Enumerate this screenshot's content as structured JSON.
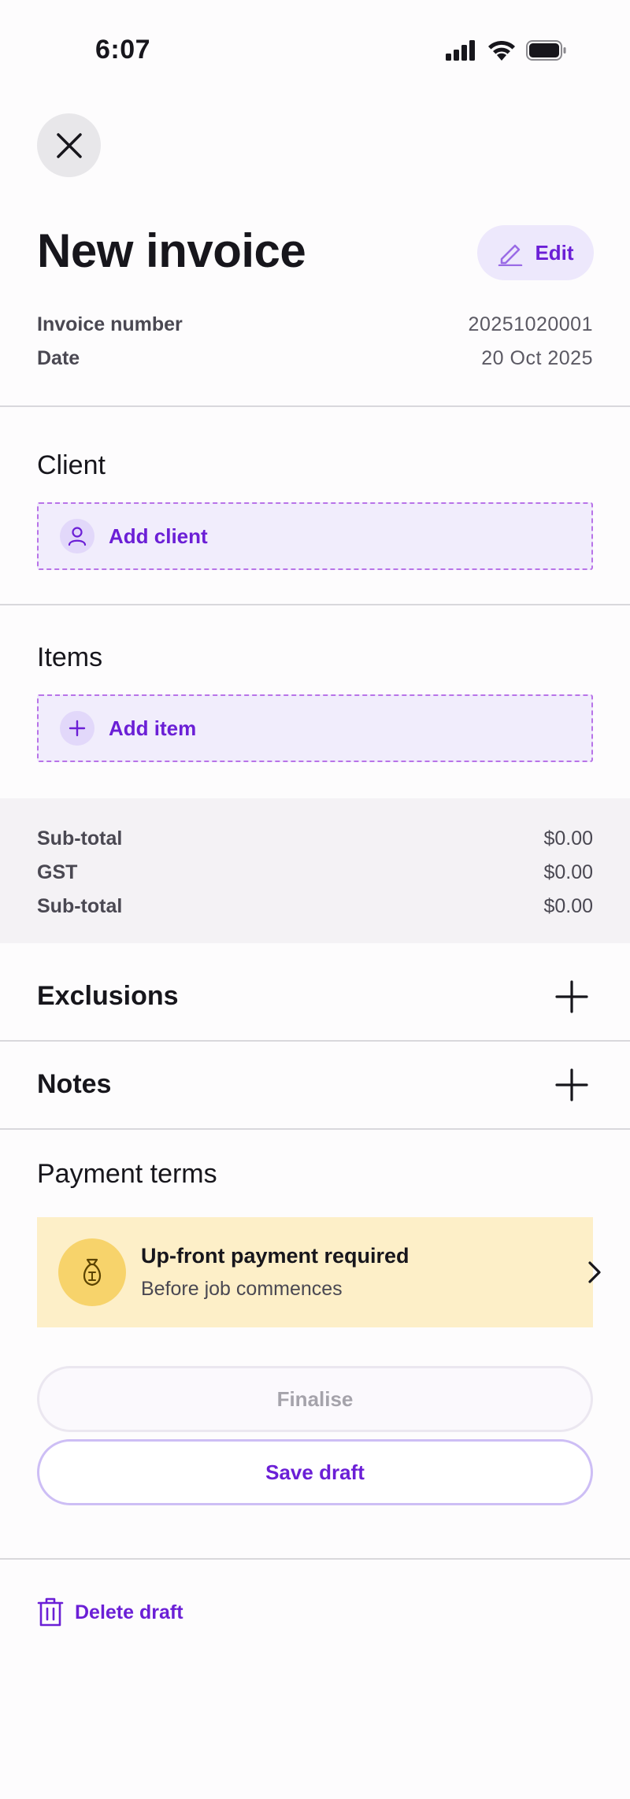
{
  "status_bar": {
    "time": "6:07"
  },
  "header": {
    "title": "New invoice",
    "edit_label": "Edit"
  },
  "meta": {
    "invoice_number_label": "Invoice number",
    "invoice_number_value": "20251020001",
    "date_label": "Date",
    "date_value": "20 Oct 2025"
  },
  "client": {
    "title": "Client",
    "add_label": "Add client"
  },
  "items": {
    "title": "Items",
    "add_label": "Add item"
  },
  "totals": [
    {
      "label": "Sub-total",
      "value": "$0.00"
    },
    {
      "label": "GST",
      "value": "$0.00"
    },
    {
      "label": "Sub-total",
      "value": "$0.00"
    }
  ],
  "exclusions": {
    "label": "Exclusions"
  },
  "notes": {
    "label": "Notes"
  },
  "payment_terms": {
    "title": "Payment terms",
    "card_title": "Up-front payment required",
    "card_subtitle": "Before job commences"
  },
  "actions": {
    "finalise_label": "Finalise",
    "save_draft_label": "Save draft",
    "delete_label": "Delete draft"
  },
  "colors": {
    "accent": "#6B1FD6",
    "payment_card_bg": "#FDEFC8",
    "dashed_border": "#B873E8"
  }
}
